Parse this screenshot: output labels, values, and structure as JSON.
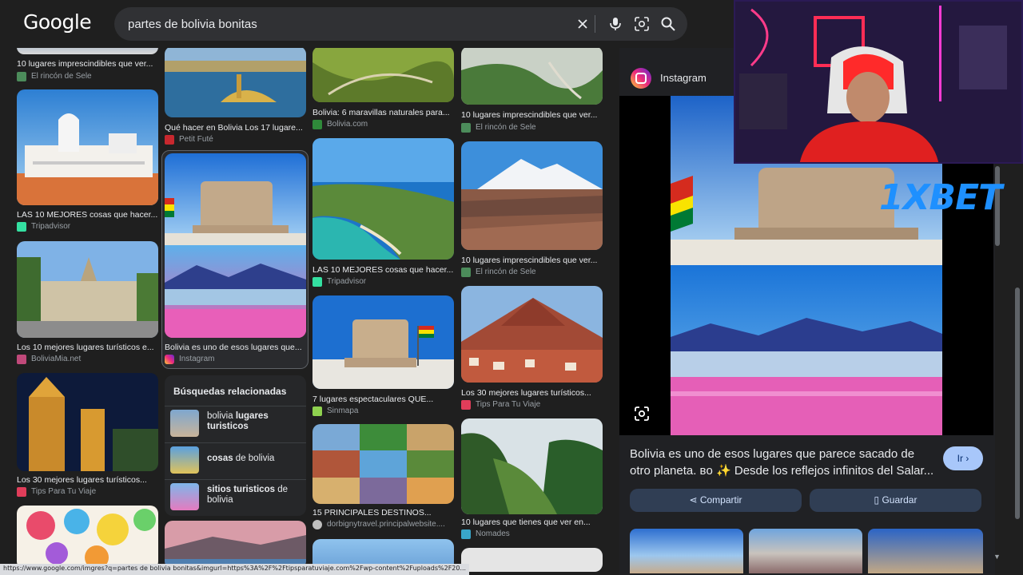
{
  "header": {
    "logo": "Google",
    "query": "partes de bolivia bonitas"
  },
  "results": {
    "col1": [
      {
        "caption": "10 lugares imprescindibles que ver...",
        "source": "El rincón de Sele"
      },
      {
        "caption": "LAS 10 MEJORES cosas que hacer...",
        "source": "Tripadvisor"
      },
      {
        "caption": "Los 10 mejores lugares turísticos e...",
        "source": "BoliviaMia.net"
      },
      {
        "caption": "Los 30 mejores lugares turísticos...",
        "source": "Tips Para Tu Viaje"
      }
    ],
    "col2": [
      {
        "caption": "Qué hacer en Bolivia Los 17 lugare...",
        "source": "Petit Futé"
      },
      {
        "caption": "Bolivia es uno de esos lugares que...",
        "source": "Instagram"
      }
    ],
    "col3": [
      {
        "caption": "Bolivia: 6 maravillas naturales para...",
        "source": "Bolivia.com"
      },
      {
        "caption": "LAS 10 MEJORES cosas que hacer...",
        "source": "Tripadvisor"
      },
      {
        "caption": "7 lugares espectaculares QUE...",
        "source": "Sinmapa"
      },
      {
        "caption": "15 PRINCIPALES DESTINOS...",
        "source": "dorbignytravel.principalwebsite...."
      }
    ],
    "col4": [
      {
        "caption": "10 lugares imprescindibles que ver...",
        "source": "El rincón de Sele"
      },
      {
        "caption": "10 lugares imprescindibles que ver...",
        "source": "El rincón de Sele"
      },
      {
        "caption": "Los 30 mejores lugares turísticos...",
        "source": "Tips Para Tu Viaje"
      },
      {
        "caption": "10 lugares que tienes que ver en...",
        "source": "Nomades"
      }
    ]
  },
  "related": {
    "title": "Búsquedas relacionadas",
    "items": [
      {
        "plain": "bolivia ",
        "bold": "lugares turisticos",
        "plain_after": ""
      },
      {
        "plain": "",
        "bold": "cosas",
        "plain_after": " de bolivia"
      },
      {
        "plain": "",
        "bold": "sitios turisticos",
        "plain_after": " de bolivia"
      }
    ]
  },
  "panel": {
    "source": "Instagram",
    "description": "Bolivia es uno de esos lugares que parece sacado de otro planeta. ʙᴏ ✨ Desde los reflejos infinitos del Salar...",
    "visit_label": "Ir",
    "share_label": "Compartir",
    "save_label": "Guardar"
  },
  "overlay": {
    "sponsor": "1XBET"
  },
  "status_url": "https://www.google.com/imgres?q=partes de bolivia bonitas&imgurl=https%3A%2F%2Ftipsparatuviaje.com%2Fwp-content%2Fuploads%2F20...",
  "colors": {
    "background": "#1f1f1f",
    "search_bar": "#303134",
    "primary_button": "#a8c7fa",
    "secondary_button": "#303e54"
  }
}
